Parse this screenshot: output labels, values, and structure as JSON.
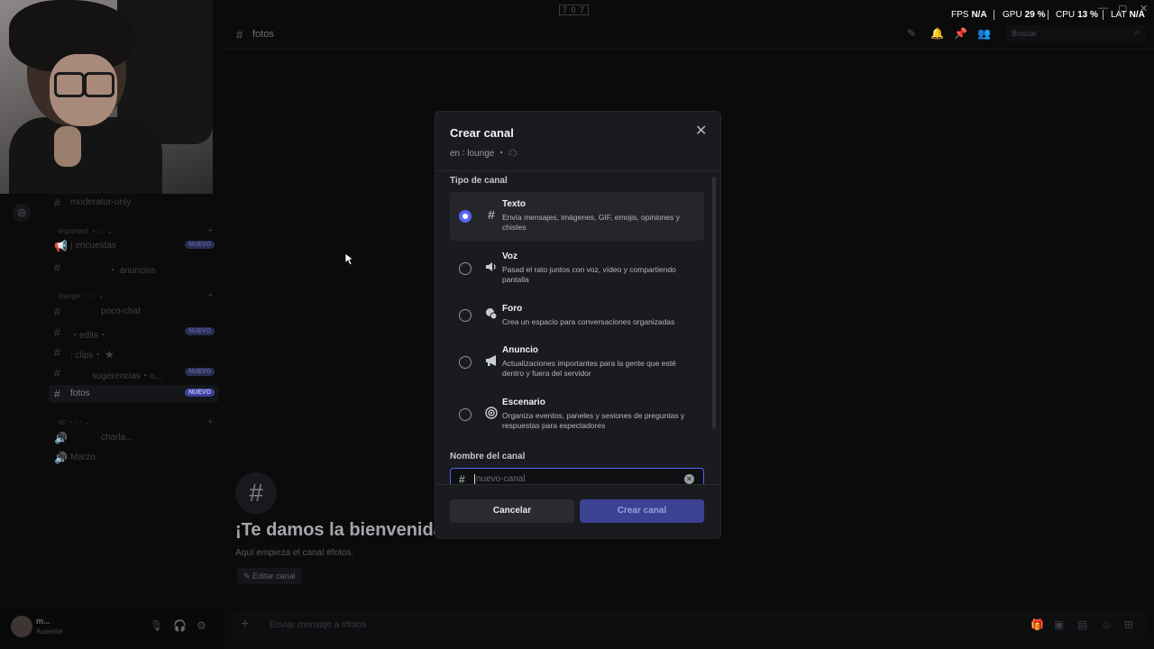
{
  "header": {
    "title_mark": "7 0 7",
    "channel_name": "fotos",
    "search_placeholder": "Buscar"
  },
  "perf": [
    {
      "label": "FPS",
      "value": "N/A"
    },
    {
      "label": "GPU",
      "value": "29 %"
    },
    {
      "label": "CPU",
      "value": "13 %"
    },
    {
      "label": "LAT",
      "value": "N/A"
    }
  ],
  "sidebar": {
    "top_channel": "moderator-only",
    "categories": [
      {
        "label": ": important ・☁ ⌄"
      },
      {
        "label": ": lounge ・☁ ⌄"
      },
      {
        "label": ": vc ・☁ ⌄"
      }
    ],
    "channels": [
      {
        "name": "| encuestas",
        "badge": "NUEVO"
      },
      {
        "name": "・ anuncios",
        "badge": ""
      },
      {
        "name": "poco-chat",
        "badge": ""
      },
      {
        "name": "・edits・",
        "badge": "NUEVO"
      },
      {
        "name": ": clips・ ★",
        "badge": ""
      },
      {
        "name": "sugerencias・o...",
        "badge": "NUEVO"
      },
      {
        "name": "fotos",
        "badge": "NUEVO"
      },
      {
        "name": "charla...",
        "badge": ""
      },
      {
        "name": "Marzo",
        "badge": ""
      }
    ]
  },
  "user": {
    "name": "m...",
    "status": "Ausente"
  },
  "main": {
    "welcome_title": "¡Te damos la bienvenida a #fotos!",
    "welcome_sub": "Aquí empieza el canal #fotos.",
    "edit_label": "Editar canal",
    "composer_placeholder": "Enviar mensaje a #fotos"
  },
  "modal": {
    "title": "Crear canal",
    "subtitle": "en  ∶ lounge ・ ☁",
    "section_type": "Tipo de canal",
    "options": [
      {
        "name": "Texto",
        "desc": "Envía mensajes, imágenes, GIF, emojis, opiniones y chistes",
        "icon": "hash-icon",
        "glyph": "#",
        "selected": true
      },
      {
        "name": "Voz",
        "desc": "Pasad el rato juntos con voz, vídeo y compartiendo pantalla",
        "icon": "speaker-icon",
        "glyph": "🔊",
        "selected": false
      },
      {
        "name": "Foro",
        "desc": "Crea un espacio para conversaciones organizadas",
        "icon": "forum-icon",
        "glyph": "💬",
        "selected": false
      },
      {
        "name": "Anuncio",
        "desc": "Actualizaciones importantes para la gente que esté dentro y fuera del servidor",
        "icon": "megaphone-icon",
        "glyph": "📢",
        "selected": false
      },
      {
        "name": "Escenario",
        "desc": "Organiza eventos, paneles y sesiones de preguntas y respuestas para espectadores",
        "icon": "stage-icon",
        "glyph": "◉",
        "selected": false
      }
    ],
    "section_name": "Nombre del canal",
    "name_placeholder": "nuevo-canal",
    "cancel_label": "Cancelar",
    "create_label": "Crear canal"
  },
  "colors": {
    "accent": "#5865f2",
    "create_disabled": "#3b4193",
    "modal_bg": "#1a1b1e"
  }
}
